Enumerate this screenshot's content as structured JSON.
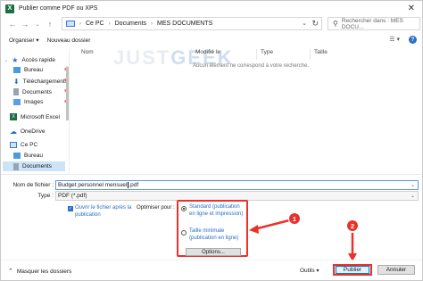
{
  "window": {
    "title": "Publier comme PDF ou XPS",
    "close_glyph": "✕"
  },
  "address": {
    "crumbs": [
      "Ce PC",
      "Documents",
      "MES DOCUMENTS"
    ],
    "search_placeholder": "Rechercher dans : MES DOCU..."
  },
  "toolbar": {
    "organize": "Organiser ▾",
    "new_folder": "Nouveau dossier"
  },
  "sidebar": {
    "items": [
      {
        "label": "Accès rapide",
        "icon": "star-icon"
      },
      {
        "label": "Bureau",
        "icon": "desktop-folder-icon"
      },
      {
        "label": "Téléchargements",
        "icon": "download-folder-icon"
      },
      {
        "label": "Documents",
        "icon": "documents-folder-icon"
      },
      {
        "label": "Images",
        "icon": "images-folder-icon"
      },
      {
        "label": "Microsoft Excel",
        "icon": "excel-icon"
      },
      {
        "label": "OneDrive",
        "icon": "cloud-icon"
      },
      {
        "label": "Ce PC",
        "icon": "pc-icon"
      },
      {
        "label": "Bureau",
        "icon": "desktop-folder-icon"
      },
      {
        "label": "Documents",
        "icon": "documents-folder-icon"
      }
    ]
  },
  "filelist": {
    "columns": [
      "Nom",
      "Modifié le",
      "Type",
      "Taille"
    ],
    "empty_message": "Aucun élément ne correspond à votre recherche.",
    "watermark_a": "JUST",
    "watermark_b": "GEEK"
  },
  "form": {
    "filename_label": "Nom de fichier :",
    "filename_value": "Budget personnel mensuel",
    "filename_ext": ".pdf",
    "type_label": "Type :",
    "type_value": "PDF (*.pdf)",
    "open_after": "Ouvrir le fichier après la publication",
    "optimize_label": "Optimiser pour :",
    "radio_standard": "Standard (publication en ligne et impression)",
    "radio_min": "Taille minimale (publication en ligne)",
    "options_button": "Options..."
  },
  "footer": {
    "hide_folders": "Masquer les dossiers",
    "tools": "Outils",
    "publish": "Publier",
    "cancel": "Annuler"
  },
  "annotations": {
    "badge1": "1",
    "badge2": "2",
    "accent_color": "#e8322b"
  }
}
